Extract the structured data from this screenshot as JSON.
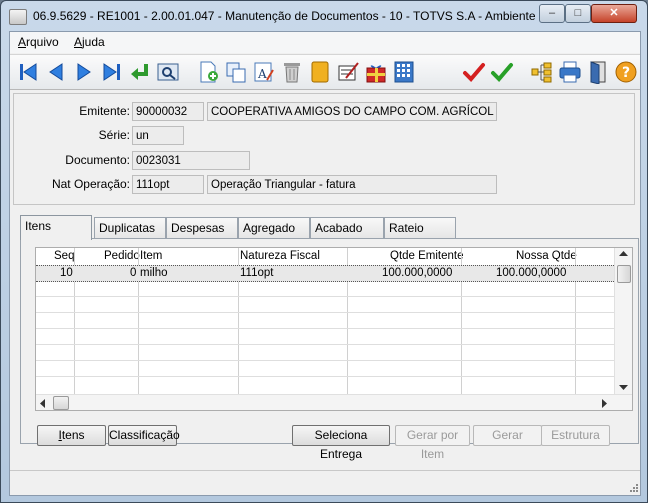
{
  "window": {
    "title": "06.9.5629 - RE1001 - 2.00.01.047 - Manutenção de Documentos - 10 - TOTVS S.A - Ambiente ..."
  },
  "menu": [
    {
      "label": "Arquivo",
      "accel": "A",
      "rest": "rquivo"
    },
    {
      "label": "Ajuda",
      "accel": "A",
      "rest": "juda"
    }
  ],
  "toolbar": {
    "icons": [
      "first-icon",
      "prev-icon",
      "next-icon",
      "last-icon",
      "goto-icon",
      "search-icon",
      "new-icon",
      "copy-icon",
      "edit-icon",
      "delete-icon",
      "cancel-icon",
      "note-icon",
      "gift-icon",
      "calc-icon",
      "confirm-icon",
      "save-icon",
      "tree-icon",
      "print-icon",
      "exit-icon",
      "help-icon"
    ]
  },
  "form": {
    "emitente_label": "Emitente:",
    "emitente_code": "90000032",
    "emitente_name": "COOPERATIVA AMIGOS DO CAMPO COM. AGRÍCOL",
    "serie_label": "Série:",
    "serie": "un",
    "documento_label": "Documento:",
    "documento": "0023031",
    "nat_label": "Nat Operação:",
    "nat_code": "111opt",
    "nat_desc": "Operação Triangular - fatura"
  },
  "tabs": [
    "Itens",
    "Duplicatas",
    "Despesas",
    "Agregado",
    "Acabado",
    "Rateio"
  ],
  "grid": {
    "columns": [
      "Seq",
      "Pedido",
      "Item",
      "Natureza Fiscal",
      "Qtde Emitente",
      "Nossa Qtde"
    ],
    "rows": [
      [
        "10",
        "0",
        "milho",
        "111opt",
        "100.000,0000",
        "100.000,0000"
      ]
    ]
  },
  "buttons": {
    "itens": "Itens",
    "classificacao": "Classificação",
    "seleciona_entrega": "Seleciona Entrega",
    "gerar_por_item": "Gerar por Item",
    "gerar": "Gerar",
    "estrutura": "Estrutura"
  }
}
